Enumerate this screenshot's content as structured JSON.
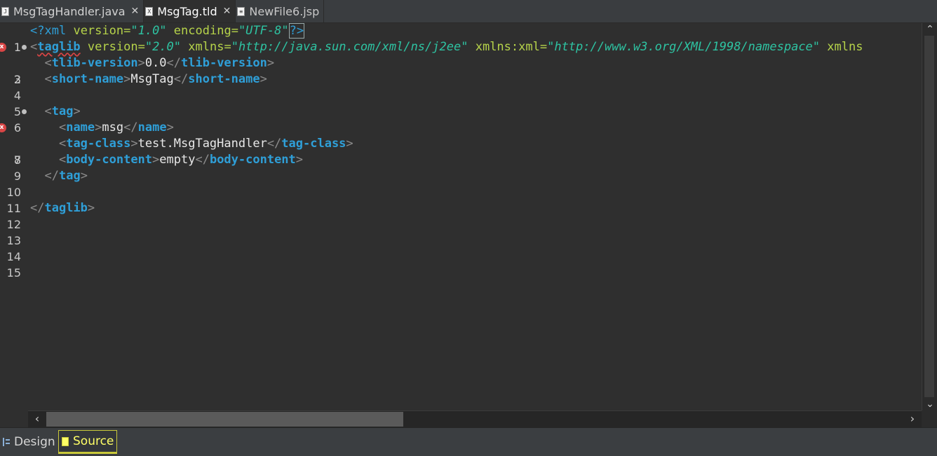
{
  "tabs": [
    {
      "label": "MsgTagHandler.java",
      "icon": "java-file-icon",
      "closable": true,
      "active": false
    },
    {
      "label": "MsgTag.tld",
      "icon": "xml-file-icon",
      "closable": true,
      "active": true
    },
    {
      "label": "NewFile6.jsp",
      "icon": "jsp-file-icon",
      "closable": false,
      "active": false
    }
  ],
  "editor": {
    "line_numbers": [
      "1",
      "2",
      "3",
      "4",
      "5",
      "6",
      "7",
      "8",
      "9",
      "10",
      "11",
      "12",
      "13",
      "14",
      "15"
    ],
    "l1": {
      "open": "<?",
      "name": "xml",
      "a1": "version",
      "eq": "=",
      "v1": "\"1.0\"",
      "a2": "encoding",
      "v2": "\"UTF-8\"",
      "close": "?>"
    },
    "l2": {
      "open": "<",
      "name": "taglib",
      "a1": "version",
      "eq": "=",
      "v1": "\"2.0\"",
      "a2": "xmlns",
      "v2": "\"http://java.sun.com/xml/ns/j2ee\"",
      "a3": "xmlns:xml",
      "v3": "\"http://www.w3.org/XML/1998/namespace\"",
      "a4": "xmlns"
    },
    "l3": {
      "lt": "<",
      "gt": ">",
      "lts": "</",
      "name": "tlib-version",
      "text": "0.0"
    },
    "l4": {
      "lt": "<",
      "gt": ">",
      "lts": "</",
      "name": "short-name",
      "text": "MsgTag"
    },
    "l6": {
      "lt": "<",
      "gt": ">",
      "name": "tag"
    },
    "l7": {
      "lt": "<",
      "gt": ">",
      "lts": "</",
      "name": "name",
      "text": "msg"
    },
    "l8": {
      "lt": "<",
      "gt": ">",
      "lts": "</",
      "name": "tag-class",
      "text": "test.MsgTagHandler"
    },
    "l9": {
      "lt": "<",
      "gt": ">",
      "lts": "</",
      "name": "body-content",
      "text": "empty"
    },
    "l10": {
      "lts": "</",
      "gt": ">",
      "name": "tag"
    },
    "l12": {
      "lts": "</",
      "gt": ">",
      "name": "taglib"
    },
    "error_marker": "x"
  },
  "scroll": {
    "up": "⌃",
    "down": "⌄",
    "left": "‹",
    "right": "›"
  },
  "bottom_tabs": {
    "design": "Design",
    "source": "Source"
  },
  "colors": {
    "background": "#2f2f2f",
    "tag": "#2f9fd8",
    "attribute": "#b6d34a",
    "value": "#2ec3a2",
    "text": "#e8e8e8",
    "error": "#d94545",
    "active_view": "#ffff66"
  }
}
